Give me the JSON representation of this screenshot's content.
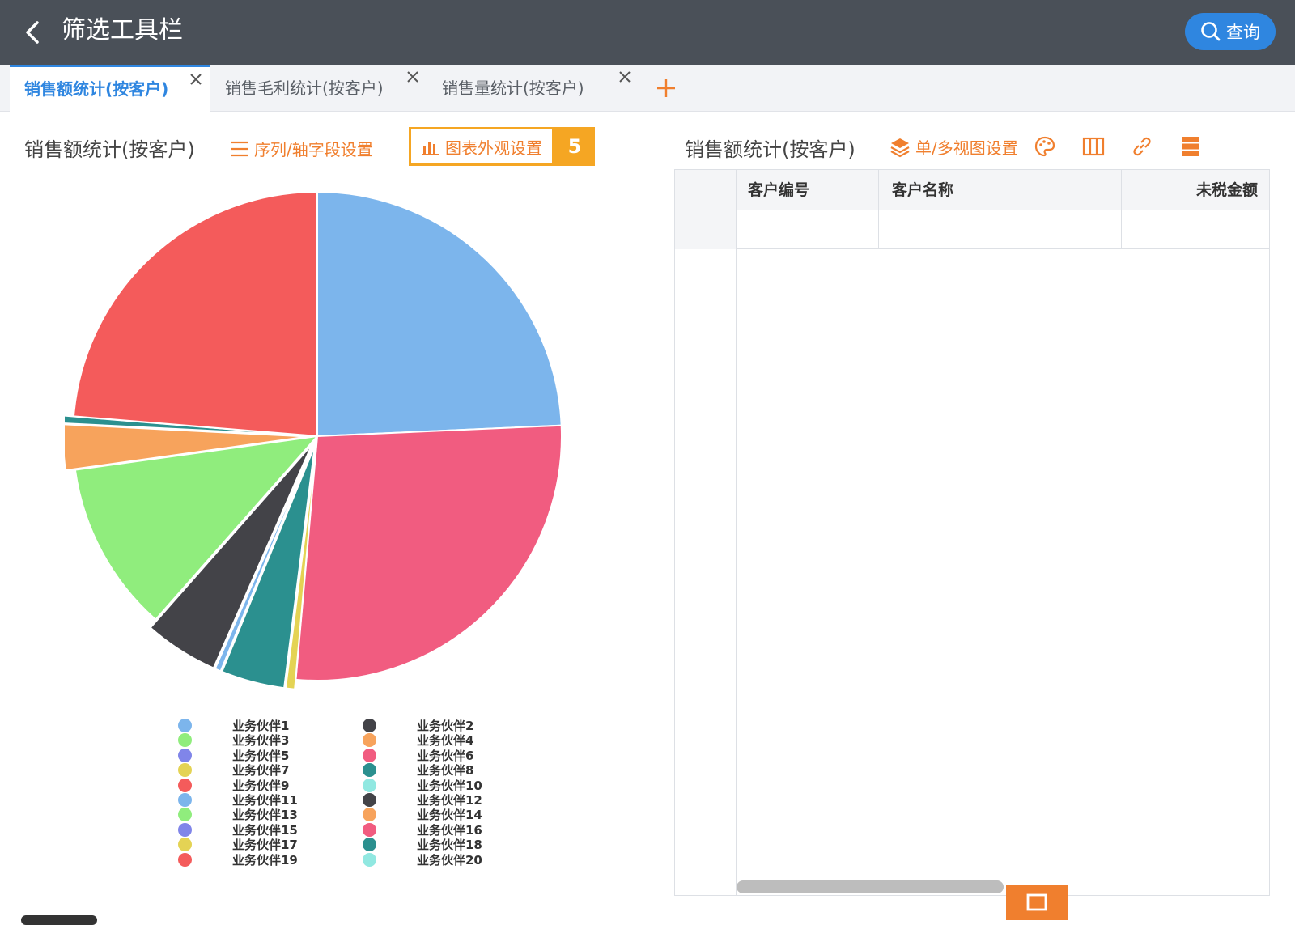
{
  "header": {
    "title": "筛选工具栏",
    "query_label": "查询"
  },
  "tabs": [
    {
      "label": "销售额统计(按客户)",
      "active": true
    },
    {
      "label": "销售毛利统计(按客户)",
      "active": false
    },
    {
      "label": "销售量统计(按客户)",
      "active": false
    }
  ],
  "left_panel": {
    "title": "销售额统计(按客户)",
    "series_settings_label": "序列/轴字段设置",
    "appearance_settings_label": "图表外观设置",
    "step_badge": "5"
  },
  "right_panel": {
    "title": "销售额统计(按客户)",
    "view_settings_label": "单/多视图设置",
    "columns": [
      "客户编号",
      "客户名称",
      "未税金额"
    ]
  },
  "colors": {
    "accent_blue": "#2f86e0",
    "accent_orange": "#f07f2e",
    "highlight_yellow": "#f5a623",
    "header_bg": "#4a5058"
  },
  "chart_data": {
    "type": "pie",
    "series": [
      {
        "name": "业务伙伴1",
        "color": "#7cb5ec",
        "value": 24.3
      },
      {
        "name": "业务伙伴6",
        "color": "#f15c80",
        "value": 27.1
      },
      {
        "name": "业务伙伴7",
        "color": "#e4d354",
        "value": 0.6
      },
      {
        "name": "业务伙伴8",
        "color": "#2b908f",
        "value": 4.2
      },
      {
        "name": "业务伙伴11",
        "color": "#7cb5ec",
        "value": 0.4
      },
      {
        "name": "业务伙伴2",
        "color": "#434348",
        "value": 4.9
      },
      {
        "name": "业务伙伴3",
        "color": "#90ed7d",
        "value": 11.3
      },
      {
        "name": "业务伙伴4",
        "color": "#f7a35c",
        "value": 3.0
      },
      {
        "name": "业务伙伴18",
        "color": "#2b908f",
        "value": 0.5
      },
      {
        "name": "业务伙伴9",
        "color": "#f45b5b",
        "value": 23.7
      }
    ],
    "legend": [
      {
        "name": "业务伙伴1",
        "color": "#7cb5ec"
      },
      {
        "name": "业务伙伴2",
        "color": "#434348"
      },
      {
        "name": "业务伙伴3",
        "color": "#90ed7d"
      },
      {
        "name": "业务伙伴4",
        "color": "#f7a35c"
      },
      {
        "name": "业务伙伴5",
        "color": "#8085e9"
      },
      {
        "name": "业务伙伴6",
        "color": "#f15c80"
      },
      {
        "name": "业务伙伴7",
        "color": "#e4d354"
      },
      {
        "name": "业务伙伴8",
        "color": "#2b908f"
      },
      {
        "name": "业务伙伴9",
        "color": "#f45b5b"
      },
      {
        "name": "业务伙伴10",
        "color": "#91e8e1"
      },
      {
        "name": "业务伙伴11",
        "color": "#7cb5ec"
      },
      {
        "name": "业务伙伴12",
        "color": "#434348"
      },
      {
        "name": "业务伙伴13",
        "color": "#90ed7d"
      },
      {
        "name": "业务伙伴14",
        "color": "#f7a35c"
      },
      {
        "name": "业务伙伴15",
        "color": "#8085e9"
      },
      {
        "name": "业务伙伴16",
        "color": "#f15c80"
      },
      {
        "name": "业务伙伴17",
        "color": "#e4d354"
      },
      {
        "name": "业务伙伴18",
        "color": "#2b908f"
      },
      {
        "name": "业务伙伴19",
        "color": "#f45b5b"
      },
      {
        "name": "业务伙伴20",
        "color": "#91e8e1"
      }
    ],
    "legend_position": "bottom"
  }
}
